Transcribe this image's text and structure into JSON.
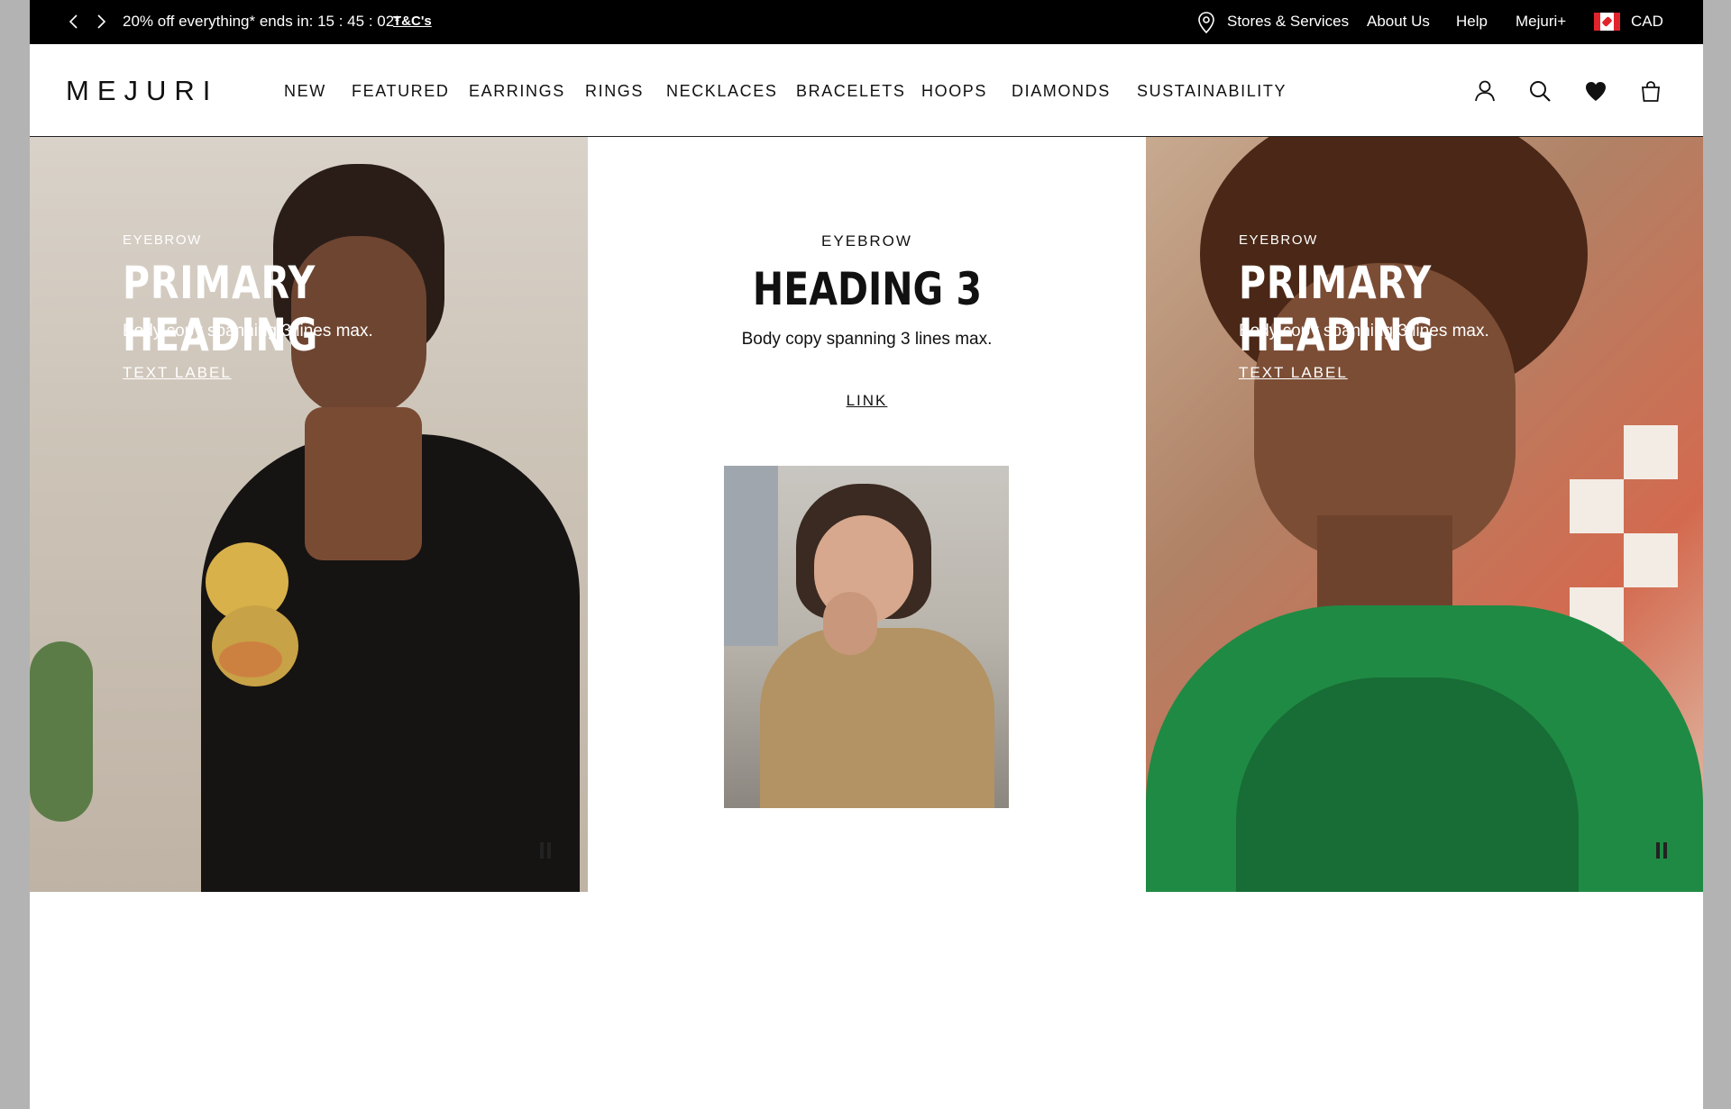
{
  "announcement": {
    "promo_text": "20% off everything* ends in: 15 : 45 : 02*",
    "terms_link": "T&C's",
    "utility_links": {
      "stores": "Stores & Services",
      "about": "About Us",
      "help": "Help",
      "mejuri_plus": "Mejuri+",
      "currency": "CAD"
    },
    "icons": [
      "chevron-left-icon",
      "chevron-right-icon",
      "location-pin-icon",
      "canada-flag-icon"
    ]
  },
  "header": {
    "logo": "MEJURI",
    "nav": [
      "NEW",
      "FEATURED",
      "EARRINGS",
      "RINGS",
      "NECKLACES",
      "BRACELETS",
      "HOOPS",
      "DIAMONDS",
      "SUSTAINABILITY"
    ],
    "icons": [
      "account-icon",
      "search-icon",
      "wishlist-heart-icon",
      "shopping-bag-icon"
    ]
  },
  "panels": {
    "left": {
      "eyebrow": "EYEBROW",
      "heading": "PRIMARY HEADING",
      "body": "Body copy spanning 3 lines max.",
      "label": "TEXT LABEL"
    },
    "center": {
      "eyebrow": "EYEBROW",
      "heading": "HEADING 3",
      "body": "Body copy spanning 3 lines max.",
      "link": "LINK"
    },
    "right": {
      "eyebrow": "EYEBROW",
      "heading": "PRIMARY HEADING",
      "body": "Body copy spanning 3 lines max.",
      "label": "TEXT LABEL"
    }
  },
  "colors": {
    "topbar_bg": "#000000",
    "text_dark": "#111111",
    "text_light": "#ffffff",
    "side_margin": "#b3b3b3"
  }
}
